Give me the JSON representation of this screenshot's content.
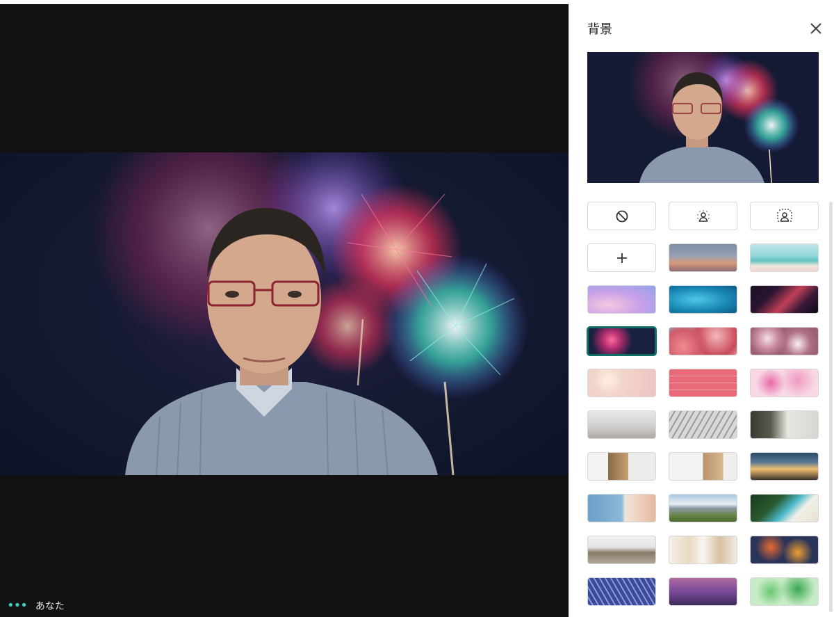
{
  "main": {
    "self_label": "あなた",
    "more_icon": "more-dots-icon"
  },
  "panel": {
    "title": "背景",
    "close_icon": "close-icon",
    "options": [
      {
        "name": "no-effect",
        "icon": "no-entry-icon"
      },
      {
        "name": "blur-light",
        "icon": "blur-light-icon"
      },
      {
        "name": "blur-strong",
        "icon": "blur-strong-icon"
      },
      {
        "name": "add-background",
        "icon": "plus-icon"
      }
    ],
    "backgrounds": [
      "sunset-horizon",
      "tropical-beach",
      "pastel-clouds",
      "underwater-pool",
      "galaxy-nebula",
      "fireworks",
      "cherry-blossoms",
      "flower-field",
      "pink-bokeh",
      "red-pattern",
      "pink-petals",
      "white-office",
      "atrium",
      "minimal-room",
      "bookshelf-room",
      "wooden-shelves",
      "night-villa",
      "seaside-town",
      "mountain-valley",
      "palm-beach",
      "wild-horses",
      "modern-kitchen",
      "autumn-leaves",
      "blue-ferns",
      "city-night",
      "green-leaves"
    ],
    "selected_background": "fireworks"
  }
}
